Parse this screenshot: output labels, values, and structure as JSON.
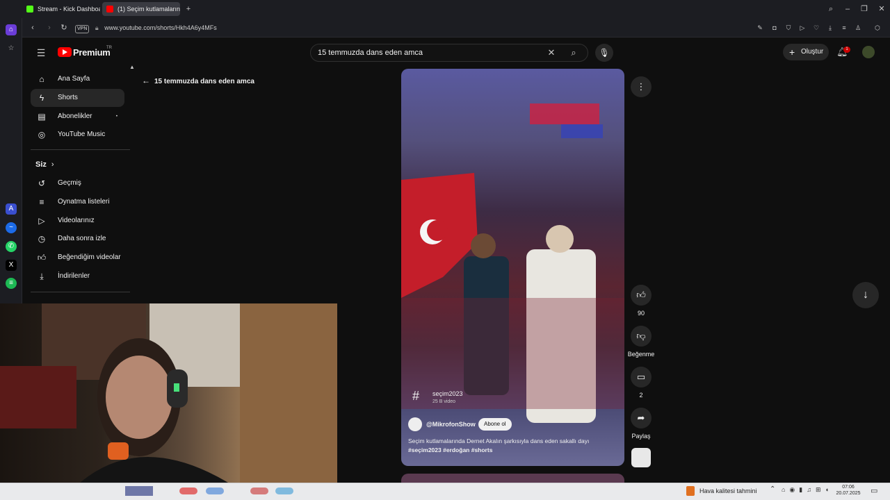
{
  "browser": {
    "tabs": [
      {
        "label": "Stream - Kick Dashboard",
        "color": "#53fc18"
      },
      {
        "label": "(1) Seçim kutlamaların",
        "color": "#ff0000"
      }
    ],
    "address": {
      "vpn": "VPN",
      "url": "www.youtube.com/shorts/Hkh4A6y4MFs"
    }
  },
  "youtube": {
    "logo_text": "Premium",
    "logo_sup": "TR",
    "search": {
      "value": "15 temmuzda dans eden amca"
    },
    "create_label": "Oluştur",
    "notification_count": "1",
    "back_title": "15 temmuzda dans eden amca",
    "sidebar": {
      "main": [
        {
          "label": "Ana Sayfa",
          "icon": "home-icon"
        },
        {
          "label": "Shorts",
          "icon": "shorts-icon",
          "active": true
        },
        {
          "label": "Abonelikler",
          "icon": "subscriptions-icon"
        },
        {
          "label": "YouTube Music",
          "icon": "music-icon"
        }
      ],
      "you_heading": "Siz",
      "you": [
        {
          "label": "Geçmiş",
          "icon": "history-icon"
        },
        {
          "label": "Oynatma listeleri",
          "icon": "playlist-icon"
        },
        {
          "label": "Videolarınız",
          "icon": "your-videos-icon"
        },
        {
          "label": "Daha sonra izle",
          "icon": "watch-later-icon"
        },
        {
          "label": "Beğendiğim videolar",
          "icon": "liked-icon"
        },
        {
          "label": "İndirilenler",
          "icon": "download-icon"
        }
      ]
    },
    "short": {
      "hashtag_title": "seçim2023",
      "hashtag_count": "25 B video",
      "channel": "@MikrofonShow",
      "subscribe_label": "Abone ol",
      "description": "Seçim kutlamalarında Dernet Akalın şarkısıyla dans eden sakallı dayı",
      "tags": "#seçim2023 #erdoğan #shorts"
    },
    "actions": {
      "likes": "90",
      "dislike_label": "Beğenme",
      "comments": "2",
      "share_label": "Paylaş"
    }
  },
  "taskbar": {
    "weather": "Hava kalitesi tahmini",
    "time": "07:06",
    "date": "20.07.2025"
  }
}
